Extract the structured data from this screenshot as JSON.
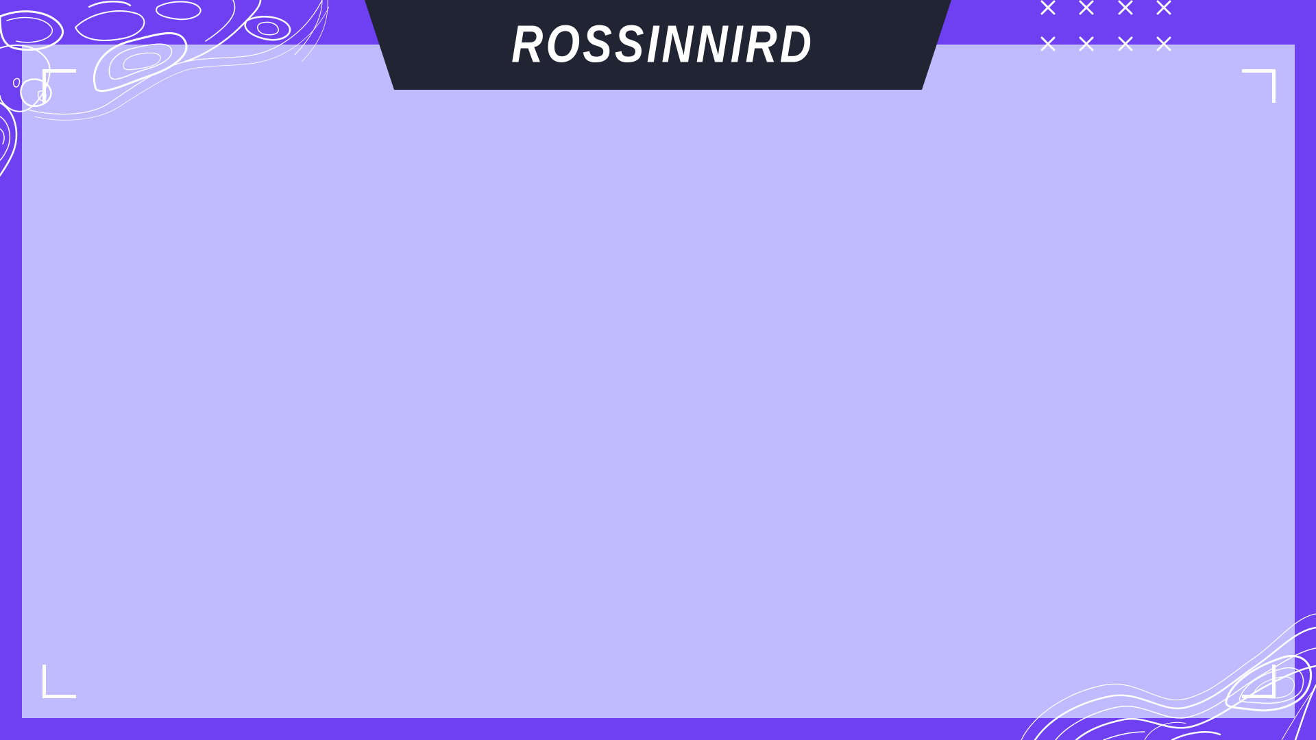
{
  "title": {
    "text": "ROSSINNIRD"
  },
  "colors": {
    "frame": "#6e40f2",
    "panel": "#c0baff",
    "banner": "#212433",
    "accent_lines": "#ffffff"
  },
  "decorations": {
    "topography_icon": "topographic-lines-icon",
    "cross_icon": "cross-mark-icon",
    "corner_icon": "corner-bracket-icon"
  }
}
